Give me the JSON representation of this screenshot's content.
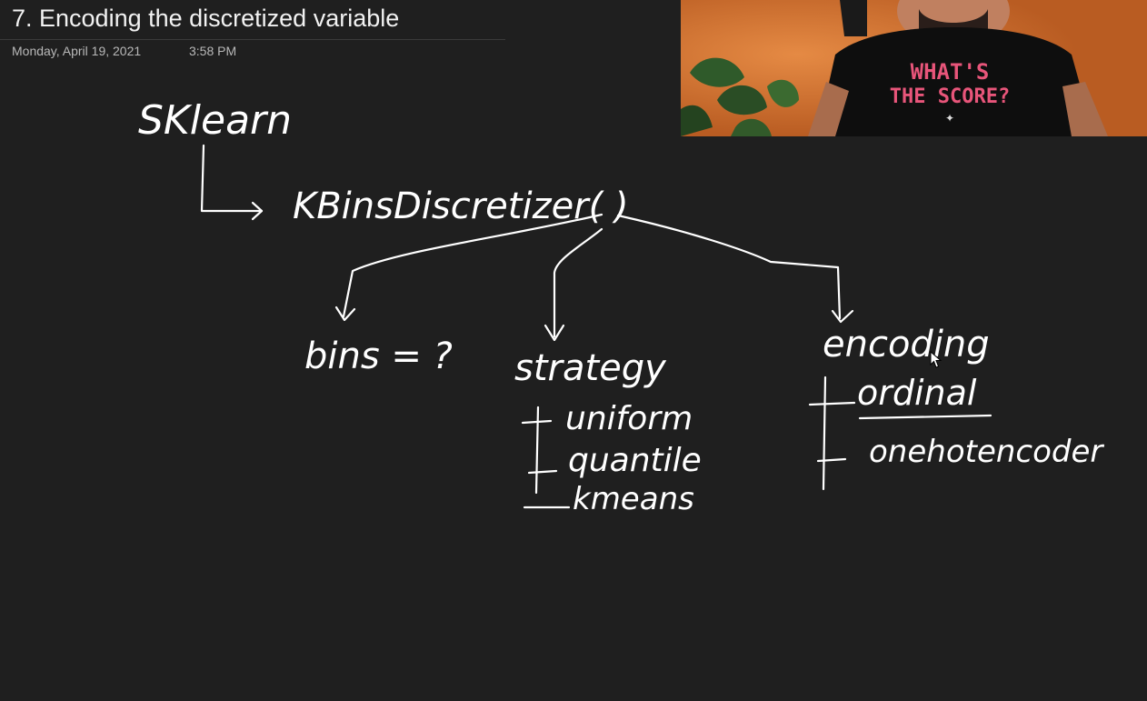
{
  "page": {
    "title": "7. Encoding the discretized variable",
    "date": "Monday, April 19, 2021",
    "time": "3:58 PM"
  },
  "notes": {
    "library": "SKlearn",
    "class_call": "KBinsDiscretizer( )",
    "bins_param": "bins = ?",
    "strategy_label": "strategy",
    "strategy_options": [
      "uniform",
      "quantile",
      "kmeans"
    ],
    "encoding_label": "encoding",
    "encoding_options": [
      "ordinal",
      "onehotencoder"
    ]
  },
  "webcam": {
    "shirt_text_line1": "WHAT'S",
    "shirt_text_line2": "THE SCORE?"
  },
  "colors": {
    "background": "#1f1f1f",
    "ink": "#ffffff",
    "shirt_text": "#e8557a"
  }
}
